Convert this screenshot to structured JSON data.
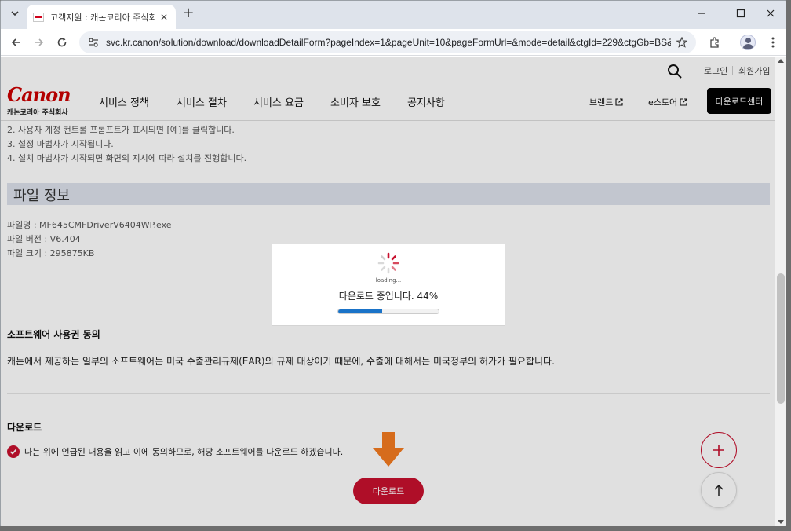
{
  "browser": {
    "tab_title": "고객지원 : 캐논코리아 주식회사",
    "url": "svc.kr.canon/solution/download/downloadDetailForm?pageIndex=1&pageUnit=10&pageFormUrl=&mode=detail&ctgId=229&ctgGb=BS&..."
  },
  "header": {
    "login": "로그인",
    "join": "회원가입",
    "logo_word": "Canon",
    "logo_sub": "캐논코리아 주식회사",
    "nav": [
      "서비스 정책",
      "서비스 절차",
      "서비스 요금",
      "소비자 보호",
      "공지사항"
    ],
    "brand": "브랜드",
    "estore": "e스토어",
    "download_center": "다운로드센터"
  },
  "content": {
    "steps": [
      "2. 사용자 계정 컨트롤 프롬프트가 표시되면 [예]를 클릭합니다.",
      "3. 설정 마법사가 시작됩니다.",
      "4. 설치 마법사가 시작되면 화면의 지시에 따라 설치를 진행합니다."
    ],
    "file_section_title": "파일 정보",
    "file_name": "파일명 : MF645CMFDriverV6404WP.exe",
    "file_version": "파일 버전 : V6.404",
    "file_size": "파일 크기 : 295875KB",
    "license_title": "소프트웨어 사용권 동의",
    "license_text": "캐논에서 제공하는 일부의 소프트웨어는 미국 수출관리규제(EAR)의 규제 대상이기 때문에, 수출에 대해서는 미국정부의 허가가 필요합니다.",
    "download_title": "다운로드",
    "agree_text": "나는 위에 언급된 내용을 읽고 이에 동의하므로, 해당 소프트웨어를 다운로드 하겠습니다.",
    "download_button": "다운로드"
  },
  "modal": {
    "loading": "loading...",
    "progress_text": "다운로드 중입니다. 44%",
    "progress": 44
  },
  "colors": {
    "brand_red": "#c8102e",
    "progress_blue": "#1a73c8",
    "arrow_orange": "#f47b20"
  }
}
